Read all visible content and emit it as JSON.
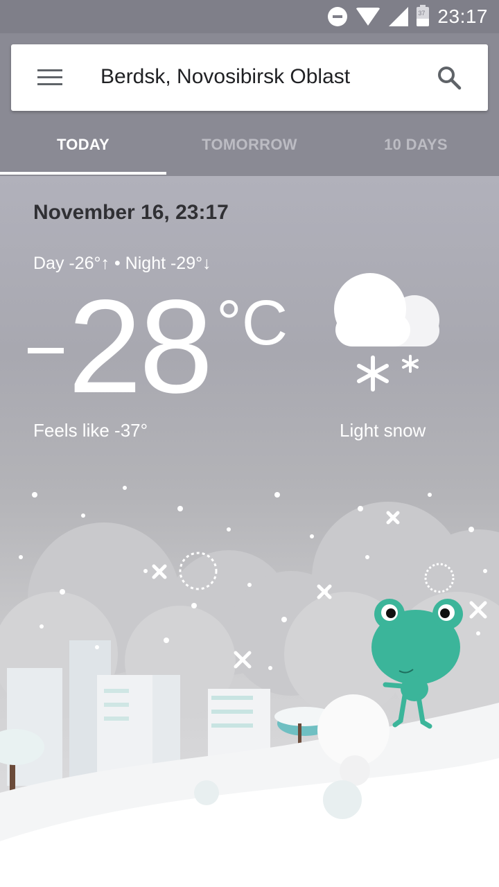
{
  "status_bar": {
    "time": "23:17",
    "battery_level": "37"
  },
  "search": {
    "location": "Berdsk, Novosibirsk Oblast"
  },
  "tabs": [
    {
      "label": "TODAY",
      "active": true
    },
    {
      "label": "TOMORROW",
      "active": false
    },
    {
      "label": "10 DAYS",
      "active": false
    }
  ],
  "weather": {
    "date": "November 16, 23:17",
    "day_night": "Day -26°↑ • Night -29°↓",
    "temperature": "28",
    "unit": "°C",
    "feels_like": "Feels like -37°",
    "condition": "Light snow"
  },
  "icons": {
    "menu": "menu-icon",
    "search": "search-icon",
    "condition": "cloud-snow-icon",
    "mascot": "frog-illustration"
  },
  "colors": {
    "status_bar": "#7f7f89",
    "header": "#8a8a94",
    "tab_active": "#ffffff",
    "tab_inactive": "#bcbcc3",
    "frog": "#3bb59a"
  }
}
